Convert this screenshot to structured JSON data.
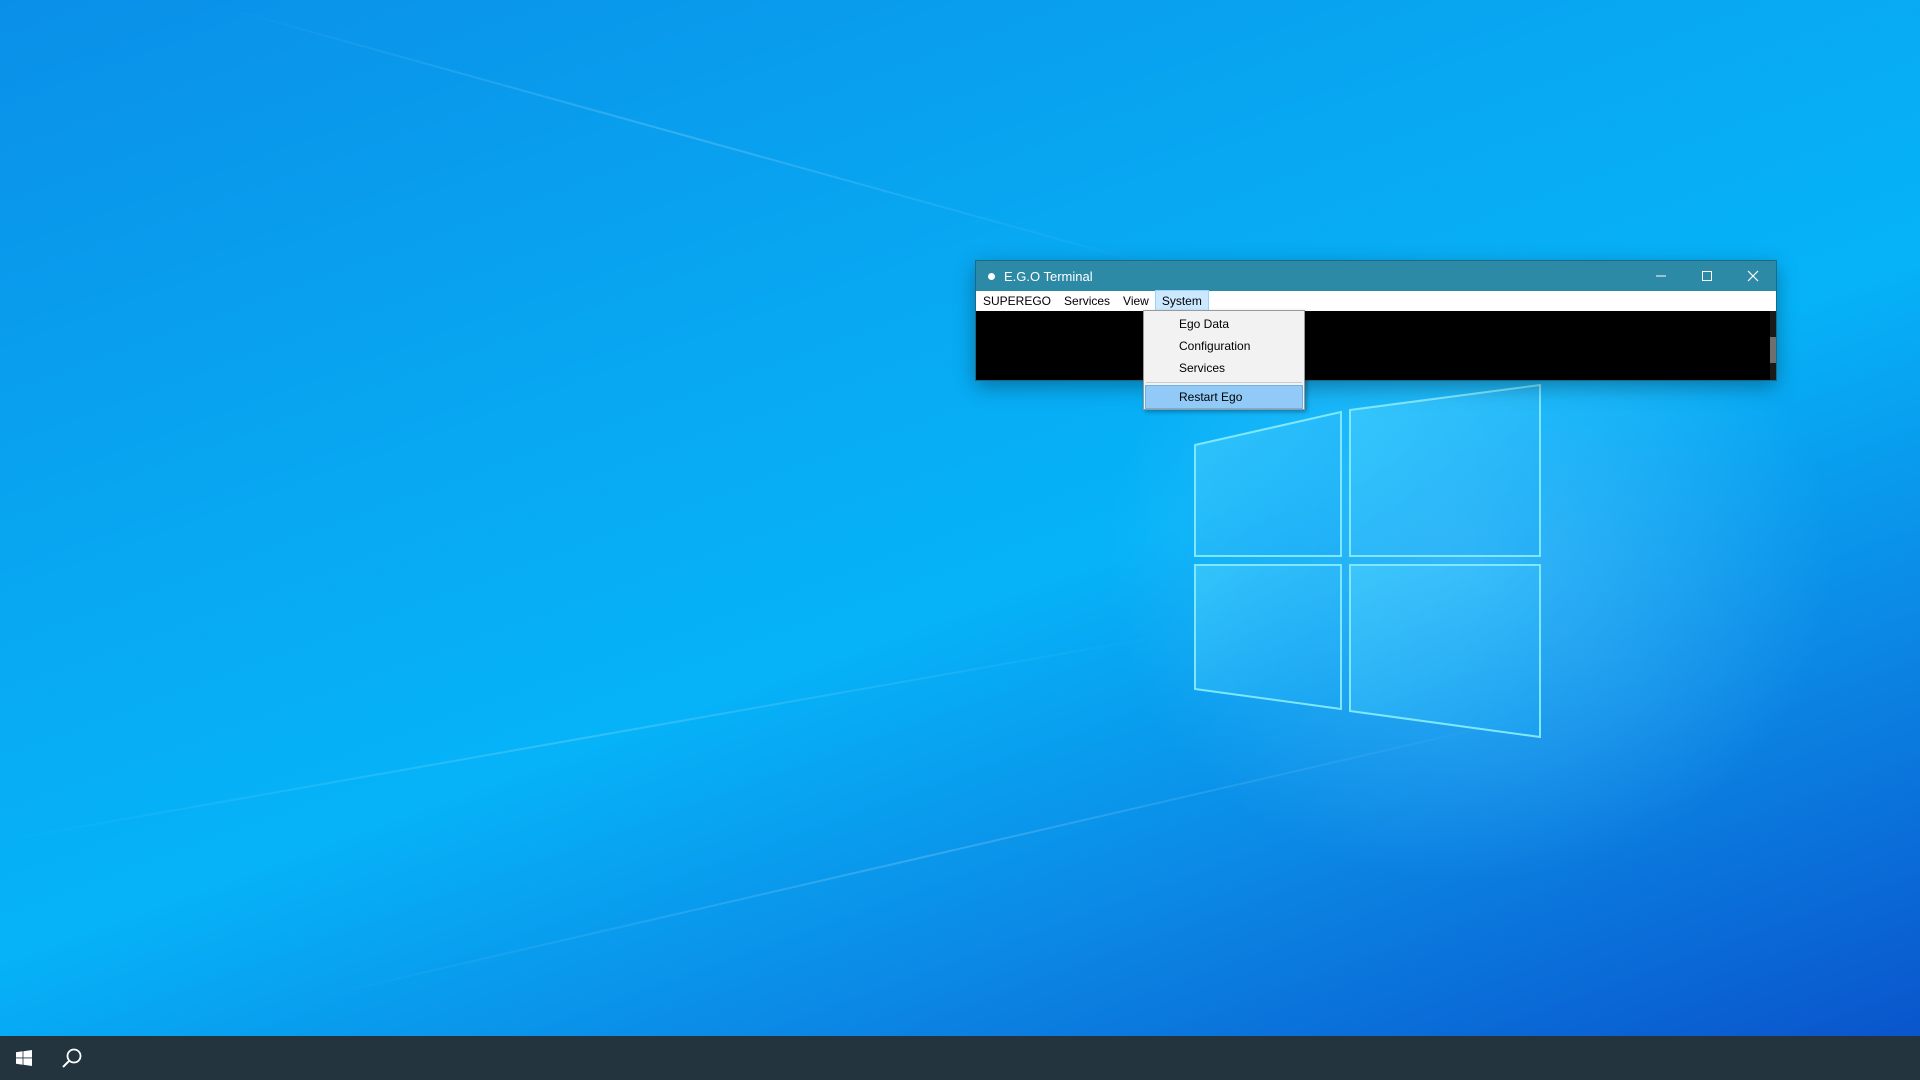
{
  "window": {
    "title": "E.G.O Terminal",
    "controls": {
      "minimize_icon": "minimize-icon",
      "maximize_icon": "maximize-icon",
      "close_icon": "close-icon"
    }
  },
  "menubar": {
    "items": [
      {
        "label": "SUPEREGO"
      },
      {
        "label": "Services"
      },
      {
        "label": "View"
      },
      {
        "label": "System",
        "active": true
      }
    ]
  },
  "dropdown": {
    "parent": "System",
    "items": [
      {
        "label": "Ego Data"
      },
      {
        "label": "Configuration"
      },
      {
        "label": "Services"
      },
      {
        "label": "Restart Ego",
        "highlighted": true
      }
    ]
  },
  "taskbar": {
    "start_icon": "windows-start-icon",
    "search_icon": "search-icon"
  },
  "colors": {
    "titlebar": "#2c8aa6",
    "menu_highlight": "#91c9f7",
    "taskbar": "#23343f",
    "terminal_bg": "#000000"
  }
}
